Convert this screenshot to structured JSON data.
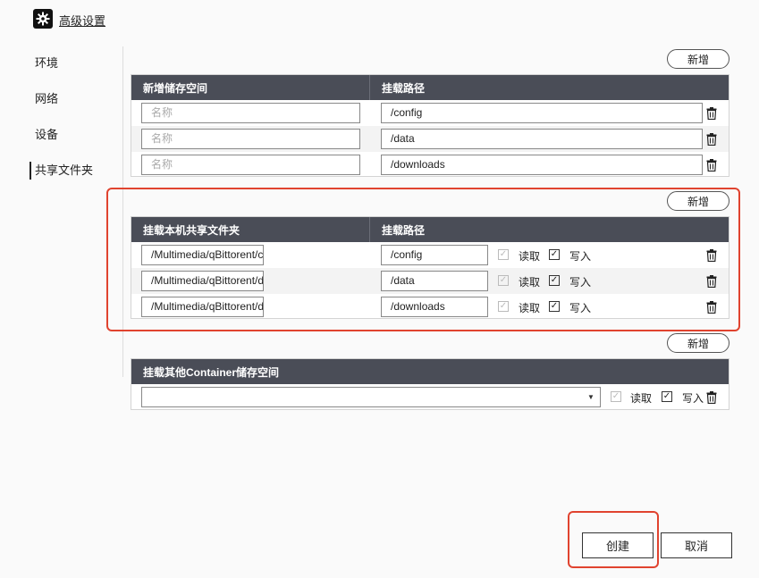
{
  "header": {
    "title": "高级设置"
  },
  "sidebar": {
    "items": [
      {
        "label": "环境"
      },
      {
        "label": "网络"
      },
      {
        "label": "设备"
      },
      {
        "label": "共享文件夹"
      }
    ]
  },
  "storage": {
    "add_label": "新增",
    "col1": "新增储存空间",
    "col2": "挂载路径",
    "name_placeholder": "名称",
    "rows": [
      {
        "path": "/config"
      },
      {
        "path": "/data"
      },
      {
        "path": "/downloads"
      }
    ]
  },
  "shared": {
    "add_label": "新增",
    "col1": "挂载本机共享文件夹",
    "col2": "挂载路径",
    "read_label": "读取",
    "write_label": "写入",
    "rows": [
      {
        "folder": "/Multimedia/qBittorent/c",
        "path": "/config"
      },
      {
        "folder": "/Multimedia/qBittorent/d",
        "path": "/data"
      },
      {
        "folder": "/Multimedia/qBittorent/d",
        "path": "/downloads"
      }
    ]
  },
  "container": {
    "add_label": "新增",
    "col1": "挂载其他Container储存空间",
    "read_label": "读取",
    "write_label": "写入"
  },
  "actions": {
    "create": "创建",
    "cancel": "取消"
  },
  "colors": {
    "header_bg": "#4a4d57",
    "highlight": "#e0432f"
  }
}
